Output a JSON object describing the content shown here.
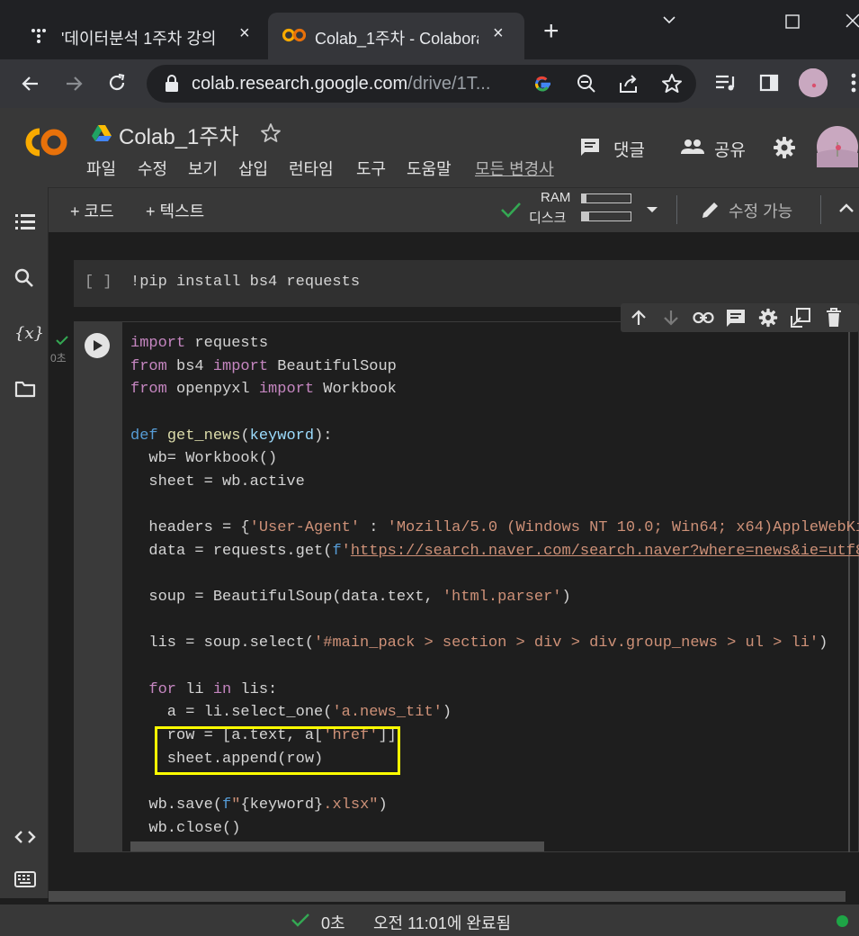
{
  "browser": {
    "tabs": [
      {
        "title": "'데이터분석 1주차 강의",
        "close": "×"
      },
      {
        "title": "Colab_1주차 - Colabora",
        "close": "×"
      }
    ],
    "new_tab": "+",
    "url_host": "colab.research.google.com",
    "url_path": "/drive/1T..."
  },
  "colab": {
    "logo": "CO",
    "notebook_title": "Colab_1주차",
    "menu": [
      "파일",
      "수정",
      "보기",
      "삽입",
      "런타임",
      "도구",
      "도움말",
      "모든 변경사"
    ],
    "comment_label": "댓글",
    "share_label": "공유",
    "add_code": "+ 코드",
    "add_text": "+ 텍스트",
    "ram_label": "RAM",
    "disk_label": "디스크",
    "ram_usage": 0.1,
    "disk_usage": 0.15,
    "edit_mode": "수정 가능",
    "sidebar_var_icon": "{x}"
  },
  "cells": {
    "cell1_bracket": "[ ]",
    "cell1_code": "!pip install bs4 requests",
    "cell2_exec_time": "0초"
  },
  "status": {
    "duration": "0초",
    "completed": "오전 11:01에 완료됨"
  },
  "colors": {
    "accent_orange": "#f9ab00",
    "highlight_yellow": "#ffff00",
    "ok_green": "#34a853",
    "status_dot": "#1ea446"
  }
}
